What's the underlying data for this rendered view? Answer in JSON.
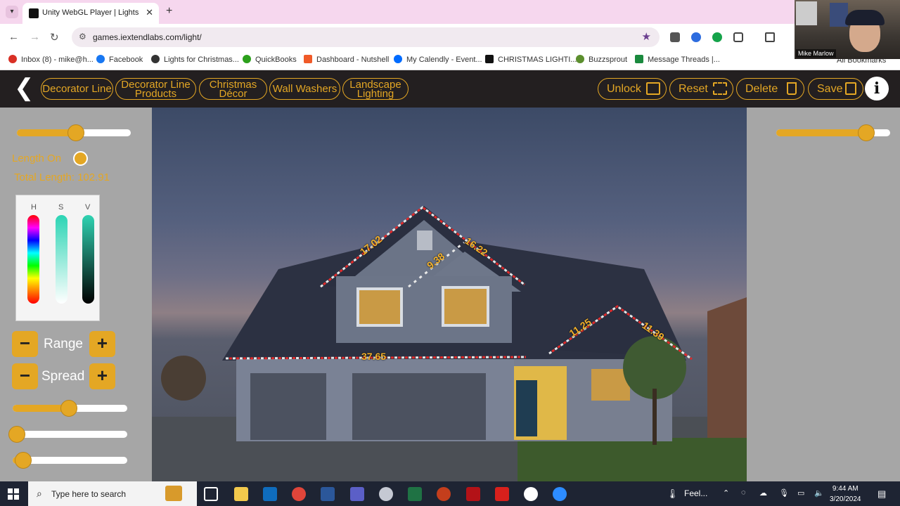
{
  "browser": {
    "tab_title": "Unity WebGL Player | Lights",
    "tab_close": "✕",
    "new_tab": "+",
    "url": "games.iextendlabs.com/light/",
    "bookmarks": [
      {
        "label": "Inbox (8) - mike@h...",
        "color": "#d93025"
      },
      {
        "label": "Facebook",
        "color": "#1877f2"
      },
      {
        "label": "Lights for Christmas...",
        "color": "#333333"
      },
      {
        "label": "QuickBooks",
        "color": "#2ca01c"
      },
      {
        "label": "Dashboard - Nutshell",
        "color": "#f05a28"
      },
      {
        "label": "My Calendly - Event...",
        "color": "#006bff"
      },
      {
        "label": "CHRISTMAS LIGHTI...",
        "color": "#111111"
      },
      {
        "label": "Buzzsprout",
        "color": "#5c8f2e"
      },
      {
        "label": "Message Threads |...",
        "color": "#1a8a3e"
      }
    ],
    "all_bookmarks": "All Bookmarks",
    "webcam_name": "Mike Marlow"
  },
  "app": {
    "nav": [
      {
        "label": "Decorator Line",
        "key": "decorator_line"
      },
      {
        "label": "Decorator Line Products",
        "key": "decorator_line_products"
      },
      {
        "label": "Christmas Décor",
        "key": "christmas_decor"
      },
      {
        "label": "Wall Washers",
        "key": "wall_washers"
      },
      {
        "label": "Landscape Lighting",
        "key": "landscape_lighting"
      }
    ],
    "actions": {
      "unlock": "Unlock",
      "reset": "Reset",
      "delete": "Delete",
      "save": "Save"
    },
    "info": "i",
    "accent": "#e4a724",
    "panel": {
      "length_on": "Length On",
      "total_length": "Total Length: 102.91",
      "hsv_labels": [
        "H",
        "S",
        "V"
      ],
      "range_label": "Range",
      "spread_label": "Spread",
      "minus": "−",
      "plus": "+",
      "top_slider": 0.52,
      "sliders": [
        0.49,
        0.03,
        0.09
      ],
      "right_slider": 0.79
    },
    "measurements": [
      "17.02",
      "9.38",
      "16.22",
      "37.65",
      "11.25",
      "11.39"
    ]
  },
  "taskbar": {
    "search_placeholder": "Type here to search",
    "weather": "Feel...",
    "time": "9:44 AM",
    "date": "3/20/2024"
  }
}
